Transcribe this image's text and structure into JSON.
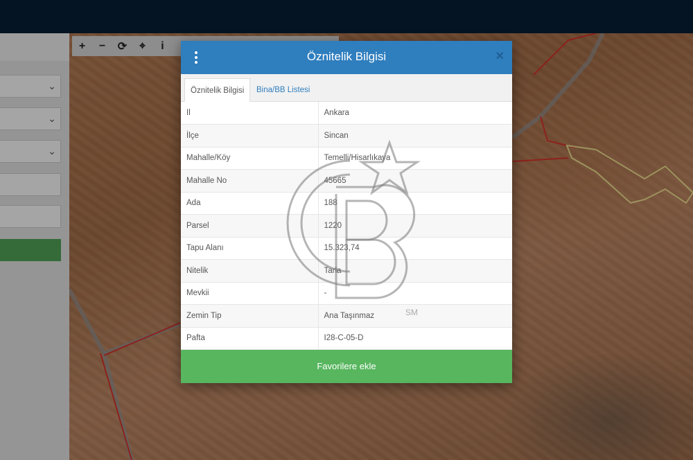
{
  "map_toolbar": {
    "zoom_in": "+",
    "zoom_out": "−",
    "refresh": "⟳",
    "locate": "⌖",
    "info": "i"
  },
  "sidepanel": {
    "select_chevron": "⌄"
  },
  "modal": {
    "title": "Öznitelik Bilgisi",
    "close": "×",
    "tabs": [
      {
        "label": "Öznitelik Bilgisi",
        "active": true
      },
      {
        "label": "Bina/BB Listesi",
        "active": false
      }
    ],
    "rows": [
      {
        "key": "Il",
        "value": "Ankara"
      },
      {
        "key": "İlçe",
        "value": "Sincan"
      },
      {
        "key": "Mahalle/Köy",
        "value": "Temelli/Hisarlıkaya"
      },
      {
        "key": "Mahalle No",
        "value": "45665"
      },
      {
        "key": "Ada",
        "value": "188"
      },
      {
        "key": "Parsel",
        "value": "1220"
      },
      {
        "key": "Tapu Alanı",
        "value": "15.323,74"
      },
      {
        "key": "Nitelik",
        "value": "Tarla"
      },
      {
        "key": "Mevkii",
        "value": "-"
      },
      {
        "key": "Zemin Tip",
        "value": "Ana Taşınmaz"
      },
      {
        "key": "Pafta",
        "value": "I28-C-05-D"
      }
    ],
    "favorite_button": "Favorilere ekle"
  },
  "watermark": {
    "mark": "SM"
  },
  "colors": {
    "header_blue": "#2f7ebe",
    "favorite_green": "#57b65e",
    "topbar": "#041422",
    "parcel_border_red": "#d0322a",
    "parcel_highlight_yellow": "#e6d88a"
  }
}
